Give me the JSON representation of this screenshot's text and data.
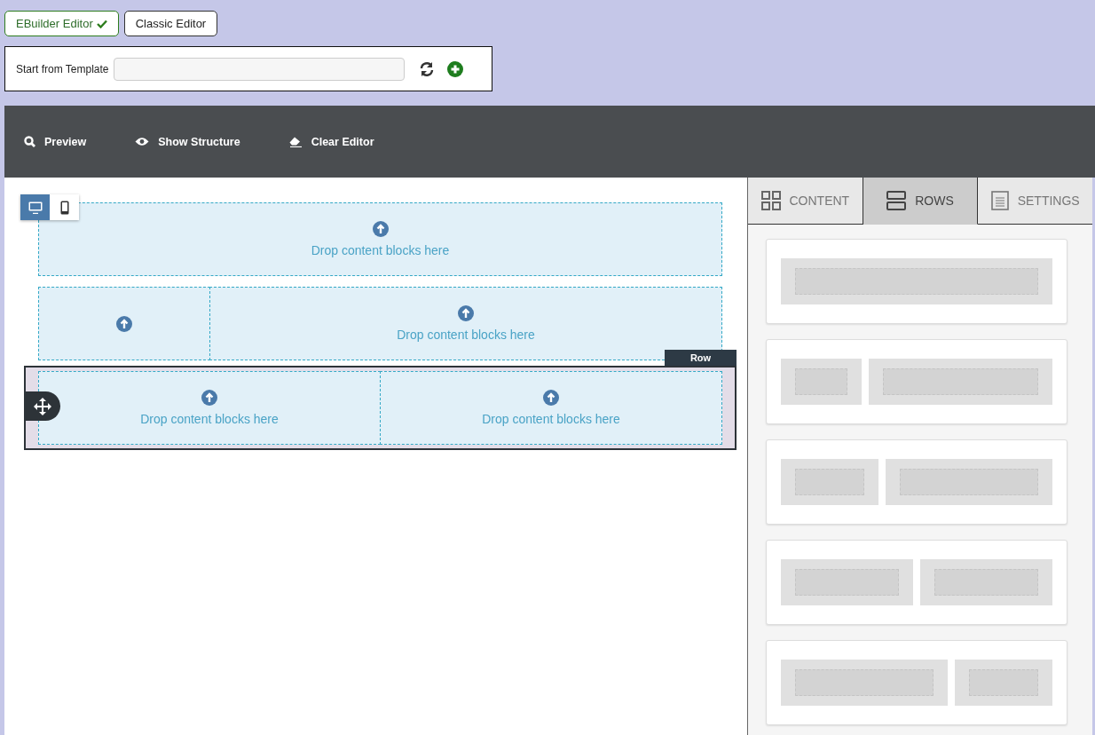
{
  "editor_modes": [
    {
      "label": "EBuilder Editor",
      "selected": true
    },
    {
      "label": "Classic Editor",
      "selected": false
    }
  ],
  "template": {
    "label": "Start from Template"
  },
  "toolbar": [
    {
      "kind": "preview",
      "label": "Preview"
    },
    {
      "kind": "structure",
      "label": "Show Structure"
    },
    {
      "kind": "clear",
      "label": "Clear Editor"
    }
  ],
  "device_toggle": [
    {
      "kind": "desktop",
      "selected": true
    },
    {
      "kind": "mobile",
      "selected": false
    }
  ],
  "rows": [
    {
      "selected": false,
      "columns": [
        {
          "kind": "full",
          "text": "Drop content blocks here"
        }
      ]
    },
    {
      "selected": false,
      "columns": [
        {
          "kind": "quarter"
        },
        {
          "kind": "three-quarters",
          "text": "Drop content blocks here"
        }
      ]
    },
    {
      "selected": true,
      "badge": "Row",
      "columns": [
        {
          "kind": "half",
          "text": "Drop content blocks here"
        },
        {
          "kind": "half",
          "text": "Drop content blocks here"
        }
      ]
    }
  ],
  "panel_tabs": [
    {
      "kind": "content",
      "label": "CONTENT",
      "selected": false
    },
    {
      "kind": "rows",
      "label": "ROWS",
      "selected": true
    },
    {
      "kind": "settings",
      "label": "SETTINGS",
      "selected": false
    }
  ],
  "row_layouts": [
    {
      "columns": [
        {
          "kind": "full"
        }
      ]
    },
    {
      "columns": [
        {
          "kind": "quarter"
        },
        {
          "kind": "three-quarters"
        }
      ]
    },
    {
      "columns": [
        {
          "kind": "third"
        },
        {
          "kind": "two-thirds"
        }
      ]
    },
    {
      "columns": [
        {
          "kind": "half"
        },
        {
          "kind": "half"
        }
      ]
    },
    {
      "columns": [
        {
          "kind": "two-thirds"
        },
        {
          "kind": "third"
        }
      ]
    }
  ]
}
